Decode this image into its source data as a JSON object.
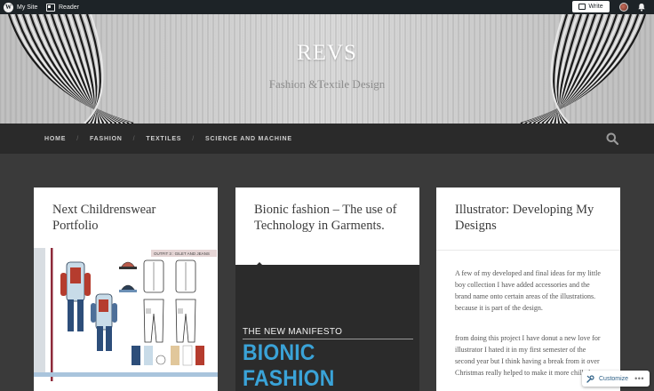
{
  "adminbar": {
    "my_site": "My Site",
    "reader": "Reader",
    "write": "Write"
  },
  "site": {
    "title": "REVS",
    "description": "Fashion &Textile Design"
  },
  "nav": {
    "items": [
      "HOME",
      "FASHION",
      "TEXTILES",
      "SCIENCE AND MACHINE"
    ],
    "separator": "/"
  },
  "posts": [
    {
      "title": "Next Childrenswear Portfolio",
      "image_label": "OUTFIT 3 : GILET AND JEANS"
    },
    {
      "title": "Bionic fashion – The use of Technology in Garments.",
      "image_subtitle": "THE NEW MANIFESTO",
      "image_title": "BIONIC FASHION"
    },
    {
      "title": "Illustrator: Developing My Designs",
      "paragraphs": [
        "A few of my developed and final ideas for my little boy collection I have added accessories and the brand name onto certain areas of the illustrations. because it is part of the design.",
        "from doing this project I have donut a new love for illustrator I hated it in my first semester of the second year but I think having a break from it over Christmas really helped to make it more chilled a"
      ]
    }
  ],
  "customize": {
    "label": "Customize",
    "more": "•••"
  },
  "colors": {
    "admin_bar": "#1d2327",
    "nav_bar": "#2a2a2a",
    "content_bg": "#3a3a3a",
    "accent_blue": "#3aa3d8"
  }
}
